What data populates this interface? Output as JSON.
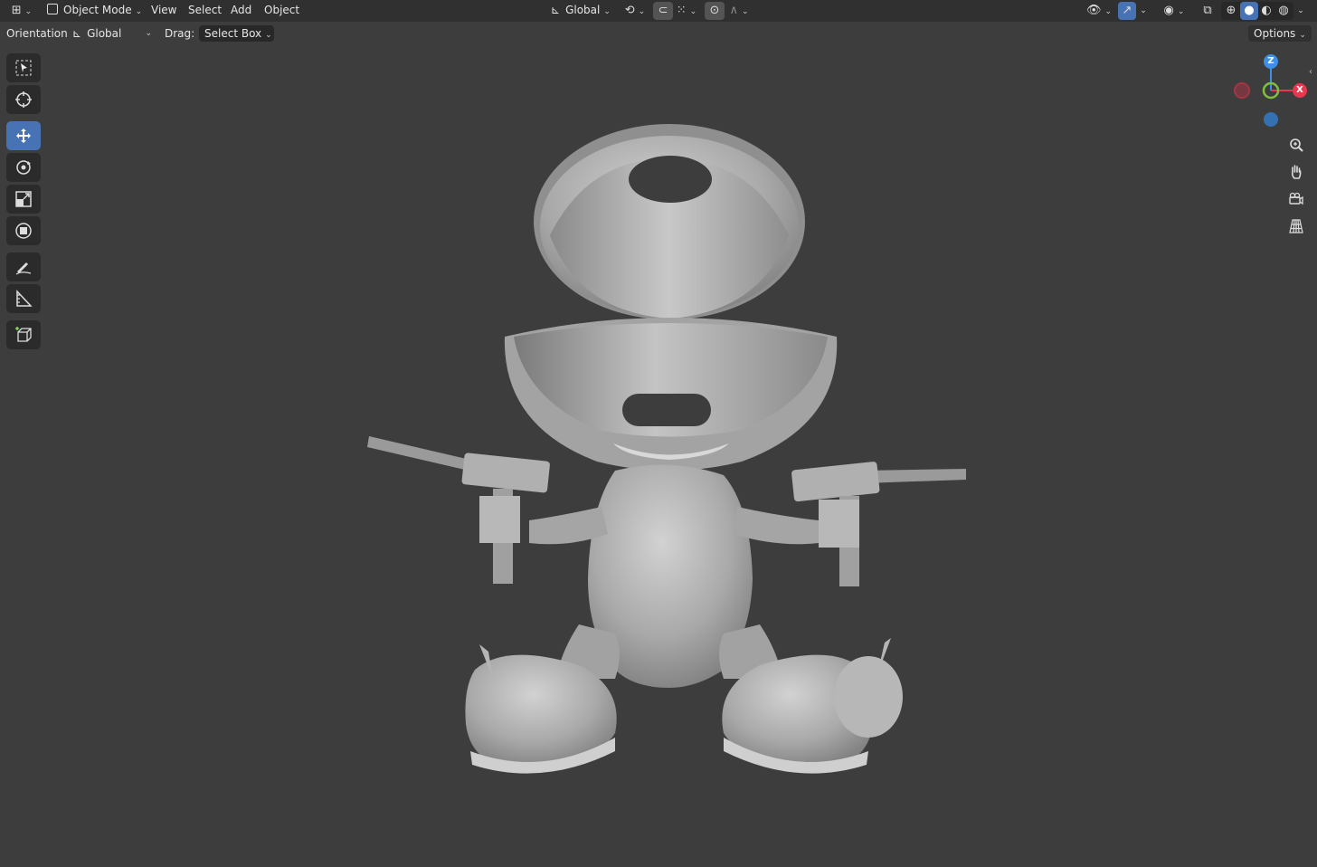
{
  "header": {
    "mode": "Object Mode",
    "menus": [
      "View",
      "Select",
      "Add",
      "Object"
    ],
    "transform_orientation": "Global"
  },
  "tool_settings": {
    "orientation_label": "Orientation:",
    "orientation_value": "Global",
    "drag_label": "Drag:",
    "drag_value": "Select Box",
    "options_label": "Options"
  },
  "gizmo": {
    "axes": [
      "Z",
      "X"
    ],
    "colors": {
      "x": "#e8384f",
      "y": "#7fbf3f",
      "z": "#3d8fe8",
      "x_neg": "#a83444",
      "z_neg": "#3570b0"
    }
  },
  "toolbar": {
    "tools": [
      "select-box",
      "cursor",
      "move",
      "rotate",
      "scale",
      "transform",
      "annotate",
      "measure",
      "add-cube"
    ],
    "active": "move"
  },
  "colors": {
    "viewport_bg": "#3d3d3d",
    "header_bg": "#303030",
    "accent": "#4772b3"
  }
}
